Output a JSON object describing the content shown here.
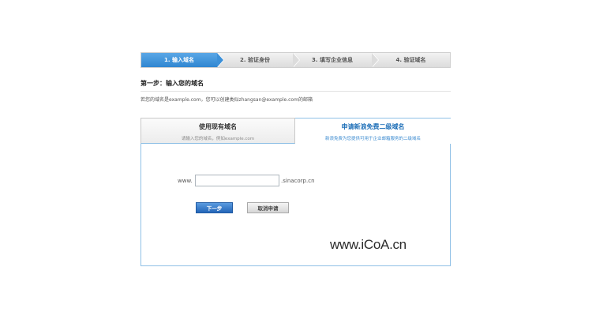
{
  "steps": [
    {
      "label": "1.  输入域名",
      "active": true
    },
    {
      "label": "2.  验证身份",
      "active": false
    },
    {
      "label": "3.  填写企业信息",
      "active": false
    },
    {
      "label": "4.  验证域名",
      "active": false
    }
  ],
  "step_title": "第一步：输入您的域名",
  "hint": "若您的域名是example.com，您可以创建类似zhangsan@example.com的邮箱",
  "tabs": {
    "left": {
      "title": "使用现有域名",
      "subtitle": "请输入您的域名，例如example.com"
    },
    "right": {
      "title": "申请新浪免费二级域名",
      "subtitle": "新浪免费为您提供可用于企业邮箱服务的二级域名"
    }
  },
  "form": {
    "prefix": "www.",
    "input_value": "",
    "input_placeholder": "",
    "suffix": ".sinacorp.cn",
    "next_label": "下一步",
    "cancel_label": "取消申请"
  },
  "watermark": "www.iCoA.cn",
  "colors": {
    "accent": "#2f86d1",
    "panel_border": "#8fc0e6",
    "tab_active_text": "#1e6fb8"
  }
}
